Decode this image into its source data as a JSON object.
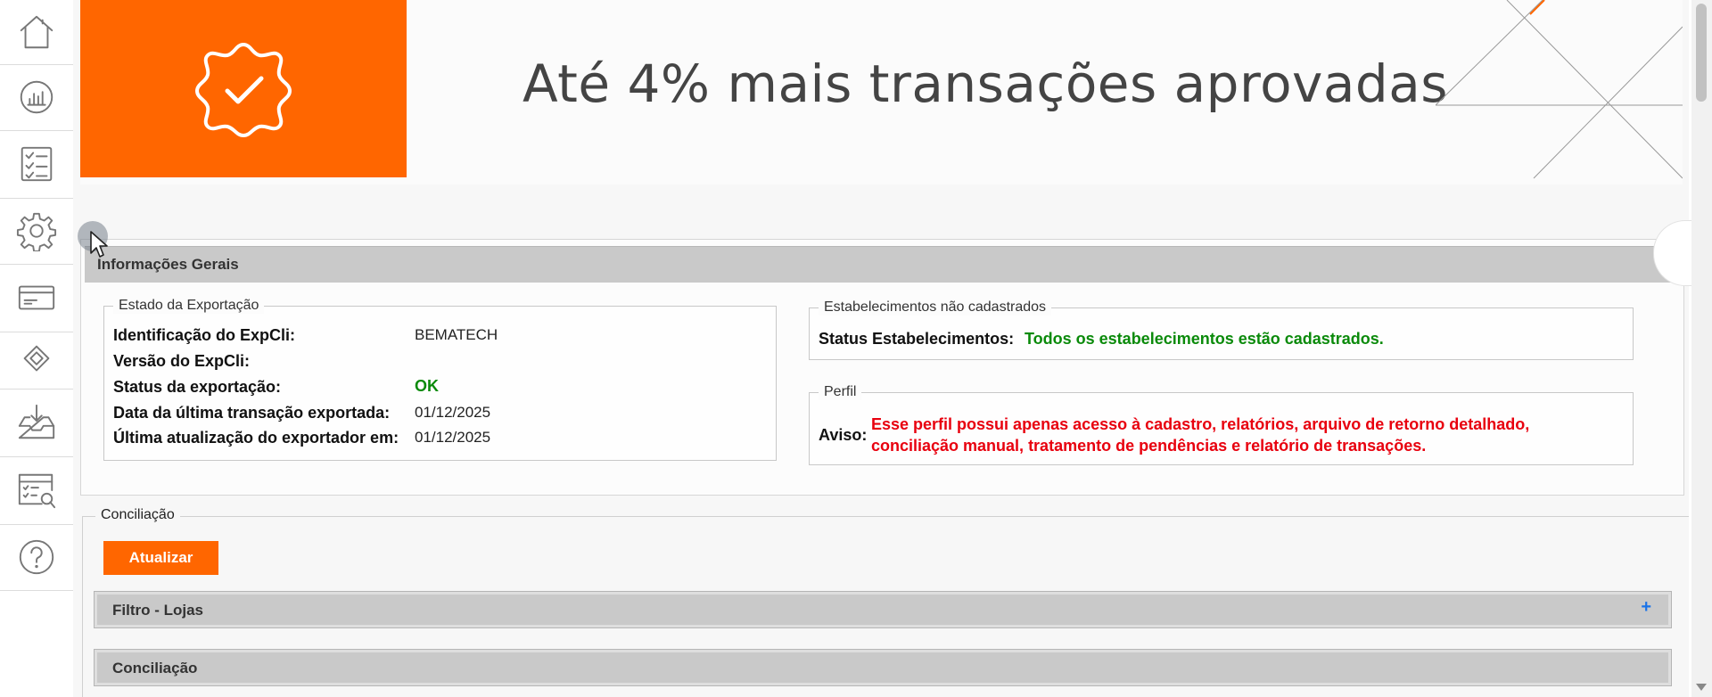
{
  "sidebar": {
    "items": [
      {
        "name": "home-icon"
      },
      {
        "name": "dashboard-chart-icon"
      },
      {
        "name": "checklist-icon"
      },
      {
        "name": "gear-icon"
      },
      {
        "name": "card-icon"
      },
      {
        "name": "diamond-transfer-icon"
      },
      {
        "name": "inbox-download-icon"
      },
      {
        "name": "report-search-icon"
      },
      {
        "name": "help-icon"
      }
    ]
  },
  "banner": {
    "headline": "Até 4% mais transações aprovadas",
    "badge_color": "#ff6600"
  },
  "info": {
    "title": "Informações Gerais",
    "export_state": {
      "legend": "Estado da Exportação",
      "rows": [
        {
          "label": "Identificação do ExpCli:",
          "value": "BEMATECH"
        },
        {
          "label": "Versão do ExpCli:",
          "value": ""
        },
        {
          "label": "Status da exportação:",
          "value": "OK"
        },
        {
          "label": "Data da última transação exportada:",
          "value": "01/12/2025"
        },
        {
          "label": "Última atualização do exportador em:",
          "value": "01/12/2025"
        }
      ],
      "ok_color": "#0a8a0a"
    },
    "establishments": {
      "legend": "Estabelecimentos não cadastrados",
      "label": "Status Estabelecimentos:",
      "value": "Todos os estabelecimentos estão cadastrados.",
      "value_color": "#0a8a0a"
    },
    "profile": {
      "legend": "Perfil",
      "label": "Aviso:",
      "line1": "Esse perfil possui apenas acesso à cadastro, relatórios, arquivo de retorno detalhado,",
      "line2": "conciliação manual, tratamento de pendências e relatório de transações.",
      "warning_color": "#e8000e"
    }
  },
  "conciliation": {
    "legend": "Conciliação",
    "refresh_label": "Atualizar",
    "filter_title": "Filtro - Lojas",
    "filter_toggle": "+",
    "section_title": "Conciliação"
  }
}
